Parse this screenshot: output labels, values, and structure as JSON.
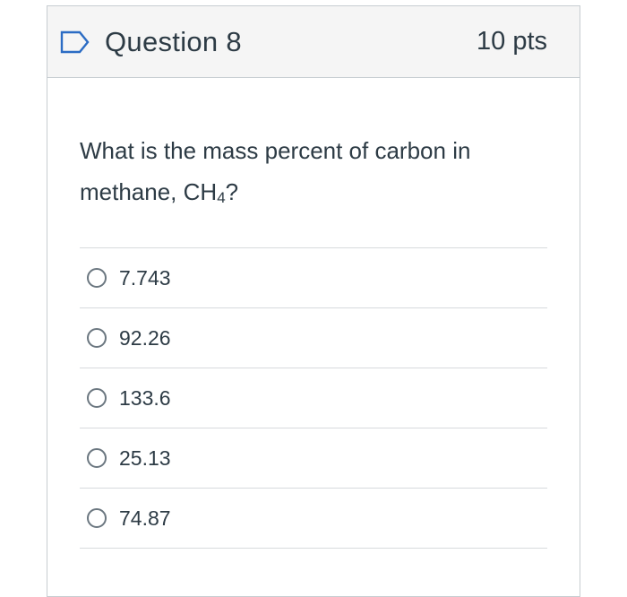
{
  "question": {
    "title": "Question 8",
    "points": "10 pts",
    "text_before": "What is the mass percent of carbon in methane, CH",
    "subscript": "4",
    "text_after": "?"
  },
  "answers": [
    {
      "label": "7.743"
    },
    {
      "label": "92.26"
    },
    {
      "label": "133.6"
    },
    {
      "label": "25.13"
    },
    {
      "label": "74.87"
    }
  ],
  "colors": {
    "text": "#2d3b45",
    "header_bg": "#f5f5f5",
    "border": "#c7cdd1",
    "divider": "#d7dadd",
    "flag_stroke": "#2b6cc4"
  },
  "icons": {
    "flag": "flag-question-icon",
    "radio": "radio-unselected-icon"
  }
}
